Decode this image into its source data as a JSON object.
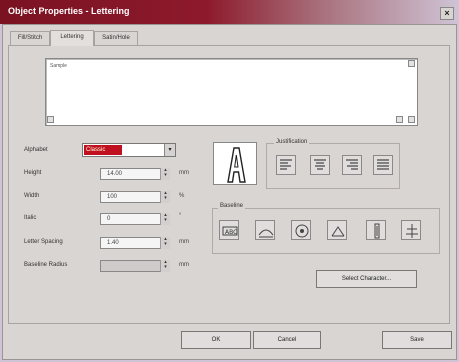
{
  "window": {
    "title": "Object Properties - Lettering",
    "close_label": "×"
  },
  "tabs": [
    {
      "label": "Fill/Stitch"
    },
    {
      "label": "Lettering"
    },
    {
      "label": "Satin/Hole"
    }
  ],
  "text_area": {
    "value": "Sample"
  },
  "fields": {
    "alphabet": {
      "label": "Alphabet",
      "value": "Classic"
    },
    "height": {
      "label": "Height",
      "value": "14.00",
      "unit": "mm"
    },
    "width": {
      "label": "Width",
      "value": "100",
      "unit": "%"
    },
    "italic": {
      "label": "Italic",
      "value": "0",
      "unit": "°"
    },
    "letter_spacing": {
      "label": "Letter Spacing",
      "value": "1.40",
      "unit": "mm"
    },
    "baseline_radius": {
      "label": "Baseline Radius",
      "value": "",
      "unit": "mm"
    }
  },
  "justification": {
    "title": "Justification"
  },
  "baseline": {
    "title": "Baseline"
  },
  "buttons": {
    "select_character": "Select Character...",
    "ok": "OK",
    "cancel": "Cancel",
    "save": "Save"
  },
  "colors": {
    "title_bar": "#8d1a2c",
    "selected_item": "#c0101f"
  },
  "icons": {
    "justification": [
      "align-left-icon",
      "align-center-icon",
      "align-right-icon",
      "align-justify-icon"
    ],
    "baseline": [
      "baseline-straight-icon",
      "baseline-bridge-icon",
      "baseline-circle-icon",
      "baseline-angle-icon",
      "baseline-vertical-icon",
      "baseline-free-icon"
    ]
  }
}
